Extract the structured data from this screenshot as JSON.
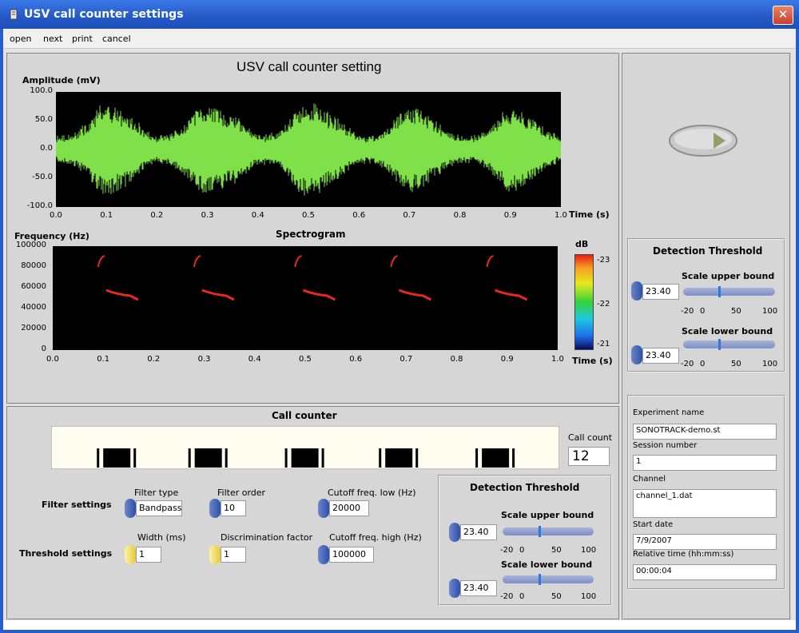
{
  "window": {
    "title": "USV call counter settings",
    "close_glyph": "✕"
  },
  "menu": {
    "items": [
      "open",
      "next",
      "print",
      "cancel"
    ]
  },
  "main_title": "USV call counter setting",
  "amplitude_plot": {
    "ylabel": "Amplitude (mV)",
    "xlabel": "Time (s)",
    "yticks": [
      "100.0",
      "50.0",
      "0.0",
      "-50.0",
      "-100.0"
    ],
    "xticks": [
      "0.0",
      "0.1",
      "0.2",
      "0.3",
      "0.4",
      "0.5",
      "0.6",
      "0.7",
      "0.8",
      "0.9",
      "1.0"
    ],
    "signal_color": "#7fe04a"
  },
  "spectrogram": {
    "title": "Spectrogram",
    "ylabel": "Frequency (Hz)",
    "xlabel": "Time (s)",
    "yticks": [
      "100000",
      "80000",
      "60000",
      "40000",
      "20000",
      "0"
    ],
    "xticks": [
      "0.0",
      "0.1",
      "0.2",
      "0.3",
      "0.4",
      "0.5",
      "0.6",
      "0.7",
      "0.8",
      "0.9",
      "1.0"
    ],
    "colorbar_label": "dB",
    "colorbar_ticks": [
      "-23",
      "-22",
      "-21"
    ],
    "call_color": "#e8281e"
  },
  "call_counter": {
    "title": "Call counter",
    "count_label": "Call count",
    "count_value": "12"
  },
  "filter": {
    "row_label": "Filter settings",
    "type_label": "Filter type",
    "type_value": "Bandpass",
    "order_label": "Filter order",
    "order_value": "10",
    "cutoff_low_label": "Cutoff freq. low (Hz)",
    "cutoff_low_value": "20000",
    "cutoff_high_label": "Cutoff freq. high (Hz)",
    "cutoff_high_value": "100000"
  },
  "threshold": {
    "row_label": "Threshold settings",
    "width_label": "Width (ms)",
    "width_value": "1",
    "disc_label": "Discrimination factor",
    "disc_value": "1"
  },
  "detection_bottom": {
    "title": "Detection Threshold",
    "upper_label": "Scale upper bound",
    "upper_value": "23.40",
    "lower_label": "Scale lower bound",
    "lower_value": "23.40",
    "scale_ticks": [
      "-20",
      "0",
      "50",
      "100"
    ]
  },
  "detection_right": {
    "title": "Detection Threshold",
    "upper_label": "Scale upper bound",
    "upper_value": "23.40",
    "lower_label": "Scale lower bound",
    "lower_value": "23.40",
    "scale_ticks": [
      "-20",
      "0",
      "50",
      "100"
    ]
  },
  "experiment": {
    "name_label": "Experiment name",
    "name_value": "SONOTRACK-demo.st",
    "session_label": "Session number",
    "session_value": "1",
    "channel_label": "Channel",
    "channel_value": "channel_1.dat",
    "start_label": "Start date",
    "start_value": "7/9/2007",
    "reltime_label": "Relative time (hh:mm:ss)",
    "reltime_value": "00:00:04"
  }
}
